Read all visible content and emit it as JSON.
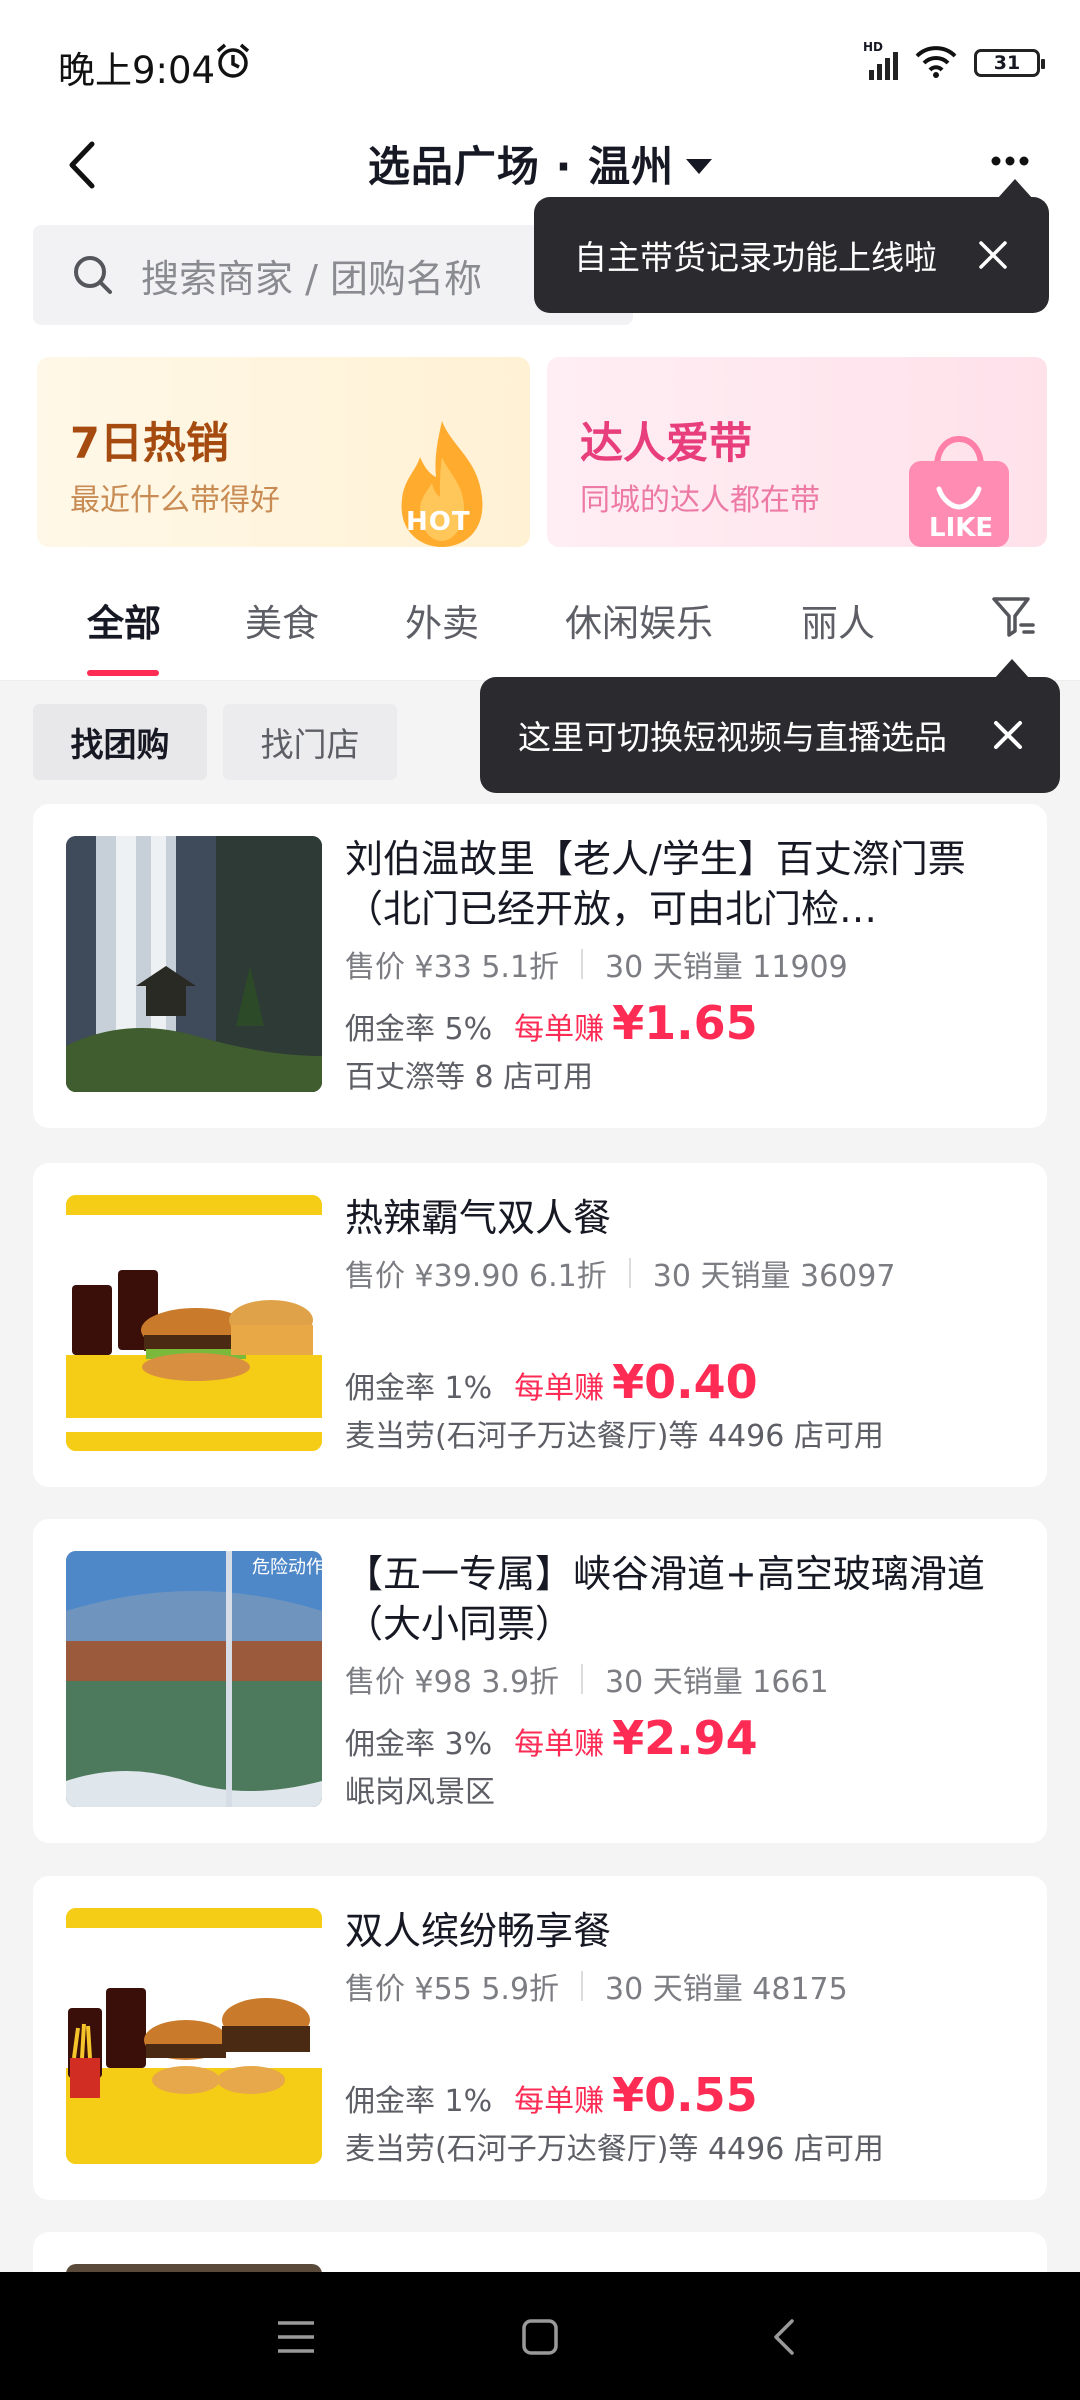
{
  "status_bar": {
    "time": "晚上9:04",
    "network_label": "HD",
    "battery": "31"
  },
  "header": {
    "title": "选品广场 · 温州"
  },
  "search": {
    "placeholder": "搜索商家 / 团购名称"
  },
  "tooltips": {
    "top": "自主带货记录功能上线啦",
    "filter": "这里可切换短视频与直播选品"
  },
  "banners": [
    {
      "title": "7日热销",
      "subtitle": "最近什么带得好",
      "badge": "HOT"
    },
    {
      "title": "达人爱带",
      "subtitle": "同城的达人都在带",
      "badge": "LIKE"
    }
  ],
  "tabs": [
    "全部",
    "美食",
    "外卖",
    "休闲娱乐",
    "丽人"
  ],
  "active_tab_index": 0,
  "chips": [
    "找团购",
    "找门店"
  ],
  "products": [
    {
      "name": "刘伯温故里【老人/学生】百丈漈门票（北门已经开放，可由北门检…",
      "price": "售价 ¥33 5.1折",
      "sales": "30 天销量 11909",
      "rate": "佣金率 5%",
      "earn_label": "每单赚",
      "earn": "¥1.65",
      "stores": "百丈漈等 8 店可用"
    },
    {
      "name": "热辣霸气双人餐",
      "price": "售价 ¥39.90 6.1折",
      "sales": "30 天销量 36097",
      "rate": "佣金率 1%",
      "earn_label": "每单赚",
      "earn": "¥0.40",
      "stores": "麦当劳(石河子万达餐厅)等 4496 店可用"
    },
    {
      "name": "【五一专属】峡谷滑道+高空玻璃滑道（大小同票）",
      "price": "售价 ¥98 3.9折",
      "sales": "30 天销量 1661",
      "rate": "佣金率 3%",
      "earn_label": "每单赚",
      "earn": "¥2.94",
      "stores": "岷岗风景区",
      "image_text": "危险动作"
    },
    {
      "name": "双人缤纷畅享餐",
      "price": "售价 ¥55 5.9折",
      "sales": "30 天销量 48175",
      "rate": "佣金率 1%",
      "earn_label": "每单赚",
      "earn": "¥0.55",
      "stores": "麦当劳(石河子万达餐厅)等 4496 店可用"
    }
  ],
  "colors": {
    "accent": "#fe2c55",
    "tooltip_bg": "#2b2b2f",
    "text": "#161823"
  }
}
